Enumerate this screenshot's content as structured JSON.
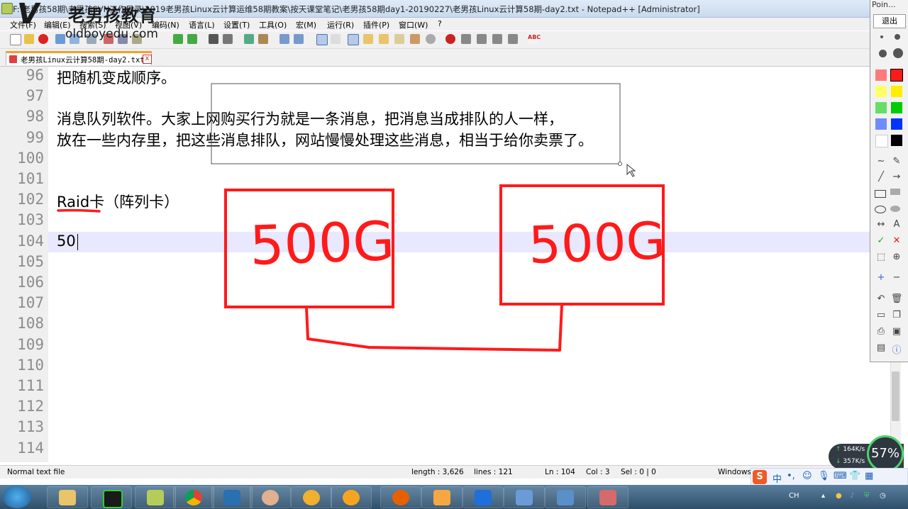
{
  "window": {
    "title": "F:\\老男孩58期\\老男孩SVN工作目录\\2019老男孩Linux云计算运维58期教案\\按天课堂笔记\\老男孩58期day1-20190227\\老男孩Linux云计算58期-day2.txt - Notepad++ [Administrator]"
  },
  "watermark": {
    "logo": "V",
    "cn": "老男孩教育",
    "en": "oldboyedu.com"
  },
  "menu": [
    "文件(F)",
    "编辑(E)",
    "搜索(S)",
    "视图(V)",
    "编码(N)",
    "语言(L)",
    "设置(T)",
    "工具(O)",
    "宏(M)",
    "运行(R)",
    "插件(P)",
    "窗口(W)",
    "?"
  ],
  "tab": {
    "label": "老男孩Linux云计算58期-day2.txt",
    "close": "x"
  },
  "editor": {
    "lines": [
      {
        "num": "96",
        "text": "把随机变成顺序。"
      },
      {
        "num": "97",
        "text": ""
      },
      {
        "num": "98",
        "text": "消息队列软件。大家上网购买行为就是一条消息，把消息当成排队的人一样，"
      },
      {
        "num": "99",
        "text": "放在一些内存里，把这些消息排队，网站慢慢处理这些消息，相当于给你卖票了。"
      },
      {
        "num": "100",
        "text": ""
      },
      {
        "num": "101",
        "text": ""
      },
      {
        "num": "102",
        "text": "Raid卡（阵列卡）"
      },
      {
        "num": "103",
        "text": ""
      },
      {
        "num": "104",
        "text": "50"
      },
      {
        "num": "105",
        "text": ""
      },
      {
        "num": "106",
        "text": ""
      },
      {
        "num": "107",
        "text": ""
      },
      {
        "num": "108",
        "text": ""
      },
      {
        "num": "109",
        "text": ""
      },
      {
        "num": "110",
        "text": ""
      },
      {
        "num": "111",
        "text": ""
      },
      {
        "num": "112",
        "text": ""
      },
      {
        "num": "113",
        "text": ""
      },
      {
        "num": "114",
        "text": ""
      }
    ],
    "annotations": {
      "box1": "500G",
      "box2": "500G"
    }
  },
  "status": {
    "filetype": "Normal text file",
    "length": "length : 3,626",
    "lines": "lines : 121",
    "ln": "Ln : 104",
    "col": "Col : 3",
    "sel": "Sel : 0 | 0",
    "eol": "Windows"
  },
  "pointofix": {
    "title": "Poin...",
    "exit": "退出",
    "text_tool": "A"
  },
  "netmon": {
    "up": "164K/s",
    "down": "357K/s",
    "cpu": "57%"
  },
  "ime": {
    "lang": "中"
  },
  "tray": {
    "lang": "CH"
  },
  "colors": {
    "annotation_red": "#ff1a1a",
    "current_line": "#e8e8ff",
    "title_bar": "#c9daee"
  }
}
